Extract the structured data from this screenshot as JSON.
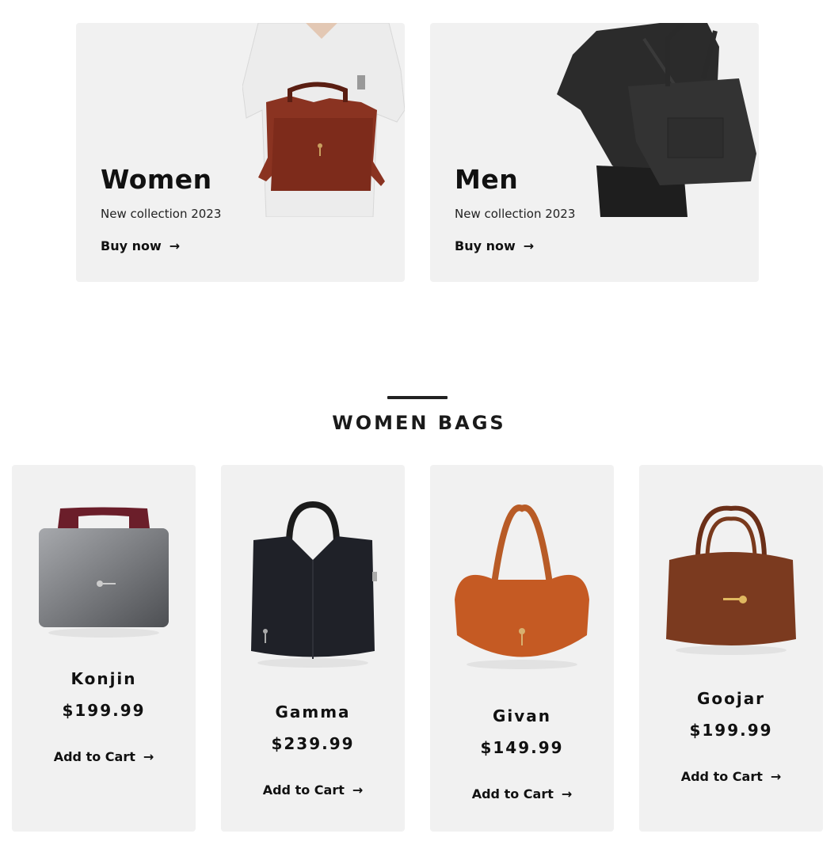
{
  "promos": [
    {
      "title": "Women",
      "subtitle": "New collection 2023",
      "cta": "Buy now"
    },
    {
      "title": "Men",
      "subtitle": "New collection 2023",
      "cta": "Buy now"
    }
  ],
  "section": {
    "title": "WOMEN BAGS"
  },
  "products": [
    {
      "name": "Konjin",
      "price": "$199.99",
      "cta": "Add to Cart"
    },
    {
      "name": "Gamma",
      "price": "$239.99",
      "cta": "Add to Cart"
    },
    {
      "name": "Givan",
      "price": "$149.99",
      "cta": "Add to Cart"
    },
    {
      "name": "Goojar",
      "price": "$199.99",
      "cta": "Add to Cart"
    }
  ],
  "icons": {
    "arrow": "arrow-right-icon"
  }
}
